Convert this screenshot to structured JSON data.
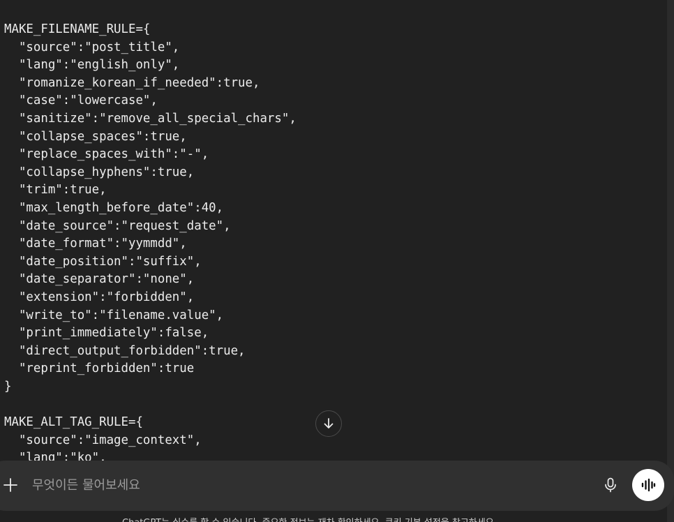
{
  "code": {
    "lines": [
      "MAKE_FILENAME_RULE={",
      "  \"source\":\"post_title\",",
      "  \"lang\":\"english_only\",",
      "  \"romanize_korean_if_needed\":true,",
      "  \"case\":\"lowercase\",",
      "  \"sanitize\":\"remove_all_special_chars\",",
      "  \"collapse_spaces\":true,",
      "  \"replace_spaces_with\":\"-\",",
      "  \"collapse_hyphens\":true,",
      "  \"trim\":true,",
      "  \"max_length_before_date\":40,",
      "  \"date_source\":\"request_date\",",
      "  \"date_format\":\"yymmdd\",",
      "  \"date_position\":\"suffix\",",
      "  \"date_separator\":\"none\",",
      "  \"extension\":\"forbidden\",",
      "  \"write_to\":\"filename.value\",",
      "  \"print_immediately\":false,",
      "  \"direct_output_forbidden\":true,",
      "  \"reprint_forbidden\":true",
      "}",
      "",
      "MAKE_ALT_TAG_RULE={",
      "  \"source\":\"image_context\",",
      "  \"lang\":\"ko\","
    ]
  },
  "scroll_down": {
    "icon": "arrow-down-icon"
  },
  "composer": {
    "placeholder": "무엇이든 물어보세요",
    "add_icon": "plus-icon",
    "mic_icon": "microphone-icon",
    "voice_icon": "voice-waveform-icon"
  },
  "disclaimer": "ChatGPT는 실수를 할 수 있습니다. 중요한 정보는 재차 확인하세요. 쿠키 기본 설정을 참고하세요."
}
